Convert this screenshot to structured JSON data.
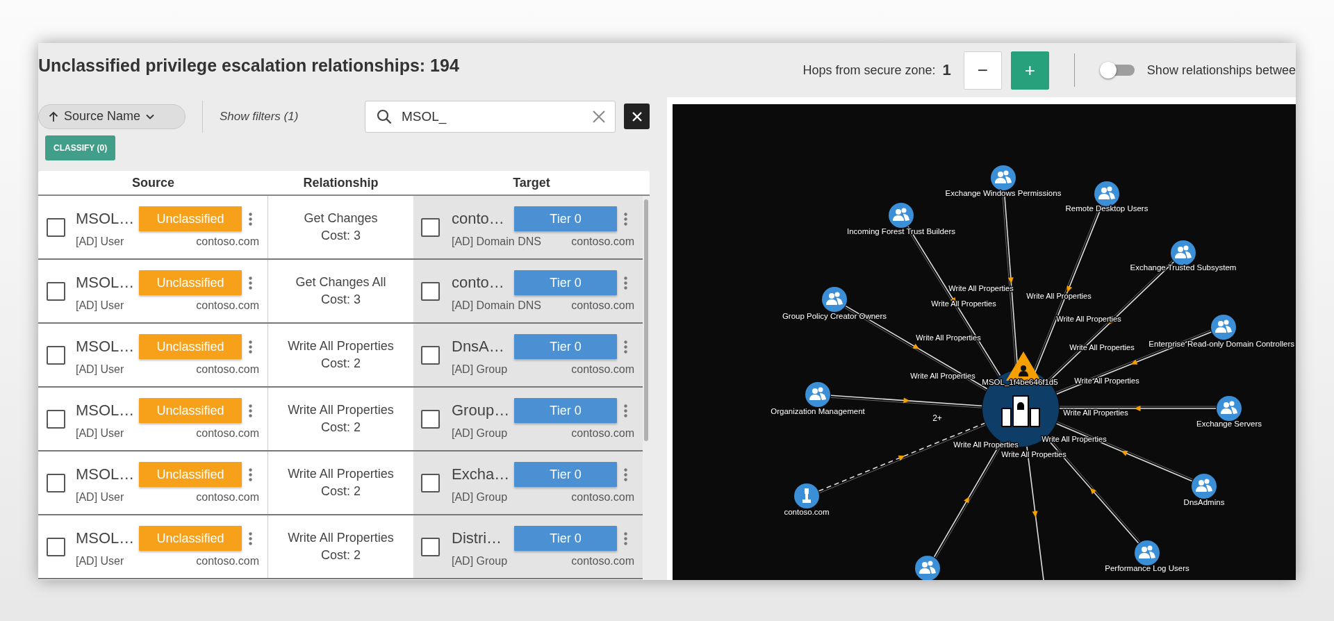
{
  "title": "Unclassified privilege escalation relationships: 194",
  "hops": {
    "label": "Hops from secure zone:",
    "value": "1",
    "decrease": "−",
    "increase": "+"
  },
  "toggle": {
    "label": "Show relationships betwee",
    "on": false
  },
  "sort": {
    "label": "Source Name"
  },
  "filters_link": "Show filters (1)",
  "search": {
    "value": "MSOL_"
  },
  "classify_button": "CLASSIFY (0)",
  "table": {
    "columns": [
      "Source",
      "Relationship",
      "Target"
    ],
    "rows": [
      {
        "source": {
          "name": "MSOL…",
          "status": "Unclassified",
          "type": "[AD] User",
          "domain": "contoso.com",
          "checked": false
        },
        "relationship": "Get Changes",
        "cost": "Cost: 3",
        "target": {
          "name": "conto…",
          "tier": "Tier 0",
          "type": "[AD] Domain DNS",
          "domain": "contoso.com",
          "checked": false
        }
      },
      {
        "source": {
          "name": "MSOL…",
          "status": "Unclassified",
          "type": "[AD] User",
          "domain": "contoso.com",
          "checked": false
        },
        "relationship": "Get Changes All",
        "cost": "Cost: 3",
        "target": {
          "name": "conto…",
          "tier": "Tier 0",
          "type": "[AD] Domain DNS",
          "domain": "contoso.com",
          "checked": false
        }
      },
      {
        "source": {
          "name": "MSOL…",
          "status": "Unclassified",
          "type": "[AD] User",
          "domain": "contoso.com",
          "checked": false
        },
        "relationship": "Write All Properties",
        "cost": "Cost: 2",
        "target": {
          "name": "DnsA…",
          "tier": "Tier 0",
          "type": "[AD] Group",
          "domain": "contoso.com",
          "checked": false
        }
      },
      {
        "source": {
          "name": "MSOL…",
          "status": "Unclassified",
          "type": "[AD] User",
          "domain": "contoso.com",
          "checked": false
        },
        "relationship": "Write All Properties",
        "cost": "Cost: 2",
        "target": {
          "name": "Group…",
          "tier": "Tier 0",
          "type": "[AD] Group",
          "domain": "contoso.com",
          "checked": false
        }
      },
      {
        "source": {
          "name": "MSOL…",
          "status": "Unclassified",
          "type": "[AD] User",
          "domain": "contoso.com",
          "checked": false
        },
        "relationship": "Write All Properties",
        "cost": "Cost: 2",
        "target": {
          "name": "Excha…",
          "tier": "Tier 0",
          "type": "[AD] Group",
          "domain": "contoso.com",
          "checked": false
        }
      },
      {
        "source": {
          "name": "MSOL…",
          "status": "Unclassified",
          "type": "[AD] User",
          "domain": "contoso.com",
          "checked": false
        },
        "relationship": "Write All Properties",
        "cost": "Cost: 2",
        "target": {
          "name": "Distri…",
          "tier": "Tier 0",
          "type": "[AD] Group",
          "domain": "contoso.com",
          "checked": false
        }
      }
    ]
  },
  "graph": {
    "center": {
      "label": "MSOL_1f4be646f1d5"
    },
    "nodes": [
      {
        "label": "Exchange Windows Permissions",
        "kind": "group",
        "dashed": false
      },
      {
        "label": "Remote Desktop Users",
        "kind": "group",
        "dashed": false
      },
      {
        "label": "Incoming Forest Trust Builders",
        "kind": "group",
        "dashed": false
      },
      {
        "label": "Exchange Trusted Subsystem",
        "kind": "group",
        "dashed": false
      },
      {
        "label": "Group Policy Creator Owners",
        "kind": "group",
        "dashed": false
      },
      {
        "label": "Enterprise Read-only Domain Controllers",
        "kind": "group",
        "dashed": false
      },
      {
        "label": "Organization Management",
        "kind": "group",
        "dashed": false
      },
      {
        "label": "Exchange Servers",
        "kind": "group",
        "dashed": false
      },
      {
        "label": "contoso.com",
        "kind": "domain",
        "dashed": true
      },
      {
        "label": "DnsAdmins",
        "kind": "group",
        "dashed": false
      },
      {
        "label": "Performance Log Users",
        "kind": "group",
        "dashed": false
      },
      {
        "kind": "group",
        "dashed": false
      }
    ],
    "edge_labels": [
      "Write All Properties",
      "Write All Properties",
      "Write All Properties",
      "Write All Properties",
      "Write All Properties",
      "Write All Properties",
      "Write All Properties",
      "Write All Properties",
      "Write All Properties",
      "Write All Properties",
      "Write All Properties",
      "Write All Properties"
    ],
    "hop_label": "2+"
  }
}
